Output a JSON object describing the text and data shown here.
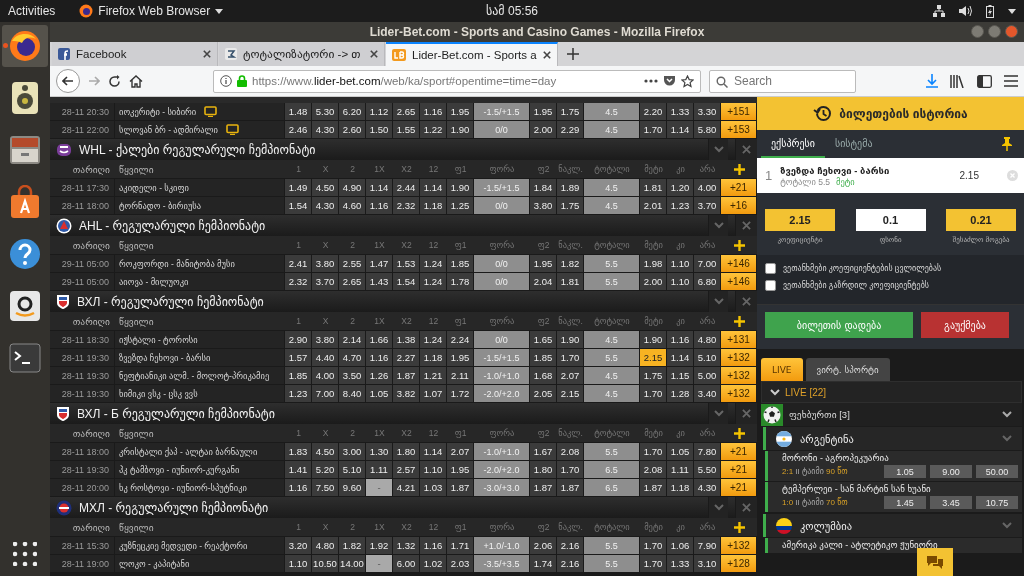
{
  "topbar": {
    "activities": "Activities",
    "app": "Firefox Web Browser",
    "clock": "სამ 05:56"
  },
  "dock": [
    {
      "kind": "firefox",
      "selected": true
    },
    {
      "kind": "music",
      "selected": false
    },
    {
      "kind": "files",
      "selected": false
    },
    {
      "kind": "software",
      "selected": false
    },
    {
      "kind": "help",
      "selected": false
    },
    {
      "kind": "amazon",
      "selected": false
    },
    {
      "kind": "terminal",
      "selected": false
    }
  ],
  "window": {
    "title": "Lider-Bet.com - Sports and Casino Games - Mozilla Firefox"
  },
  "tabs": [
    {
      "label": "Facebook",
      "kind": "facebook",
      "selected": false
    },
    {
      "label": "ტოტალიზატორი -> თ",
      "kind": "tote",
      "selected": false
    },
    {
      "label": "Lider-Bet.com - Sports a",
      "kind": "liderbet",
      "selected": true
    }
  ],
  "navbar": {
    "url": {
      "prefix": "https://www.",
      "domain": "lider-bet.com",
      "path": "/web/ka/sport#opentime=time=day"
    },
    "search": {
      "placeholder": "Search"
    }
  },
  "table": {
    "sections": [
      {
        "rows": [
          {
            "date": "28-11 20:30",
            "match": "იოკერიტი - სიბირი",
            "tv": true,
            "more": "+151",
            "odds": [
              {
                "value": "1.48",
                "selected": false,
                "disabled": false
              },
              {
                "value": "5.30",
                "selected": false,
                "disabled": false
              },
              {
                "value": "6.20",
                "selected": false,
                "disabled": false
              },
              {
                "value": "1.12",
                "selected": false,
                "disabled": false
              },
              {
                "value": "2.65",
                "selected": false,
                "disabled": false
              },
              {
                "value": "1.16",
                "selected": false,
                "disabled": false
              },
              {
                "value": "1.95",
                "selected": false,
                "disabled": false
              },
              {
                "value": "-1.5/+1.5",
                "selected": false,
                "disabled": false
              },
              {
                "value": "1.95",
                "selected": false,
                "disabled": false
              },
              {
                "value": "1.75",
                "selected": false,
                "disabled": false
              },
              {
                "value": "4.5",
                "selected": false,
                "disabled": false
              },
              {
                "value": "2.20",
                "selected": false,
                "disabled": false
              },
              {
                "value": "1.33",
                "selected": false,
                "disabled": false
              },
              {
                "value": "3.30",
                "selected": false,
                "disabled": false
              }
            ]
          },
          {
            "date": "28-11 22:00",
            "match": "სლოვან ბრ - ადმირალი",
            "tv": true,
            "more": "+153",
            "odds": [
              {
                "value": "2.46",
                "selected": false,
                "disabled": false
              },
              {
                "value": "4.30",
                "selected": false,
                "disabled": false
              },
              {
                "value": "2.60",
                "selected": false,
                "disabled": false
              },
              {
                "value": "1.50",
                "selected": false,
                "disabled": false
              },
              {
                "value": "1.55",
                "selected": false,
                "disabled": false
              },
              {
                "value": "1.22",
                "selected": false,
                "disabled": false
              },
              {
                "value": "1.90",
                "selected": false,
                "disabled": false
              },
              {
                "value": "0/0",
                "selected": false,
                "disabled": false
              },
              {
                "value": "2.00",
                "selected": false,
                "disabled": false
              },
              {
                "value": "2.29",
                "selected": false,
                "disabled": false
              },
              {
                "value": "4.5",
                "selected": false,
                "disabled": false
              },
              {
                "value": "1.70",
                "selected": false,
                "disabled": false
              },
              {
                "value": "1.14",
                "selected": false,
                "disabled": false
              },
              {
                "value": "5.80",
                "selected": false,
                "disabled": false
              }
            ]
          }
        ]
      },
      {
        "title": "WHL - ქალები რეგულარული ჩემპიონატი",
        "kind": "whl",
        "columns": [
          "თარიღი",
          "წყვილი",
          "1",
          "X",
          "2",
          "1X",
          "X2",
          "12",
          "ფ1",
          "ფორა",
          "ფ2",
          "ნაკლ.",
          "ტოტალი",
          "მეტი",
          "კი",
          "არა"
        ],
        "rows": [
          {
            "date": "28-11 17:30",
            "match": "აკიდელი - სკიფი",
            "tv": false,
            "more": "+21",
            "odds": [
              {
                "value": "1.49",
                "selected": false,
                "disabled": false
              },
              {
                "value": "4.50",
                "selected": false,
                "disabled": false
              },
              {
                "value": "4.90",
                "selected": false,
                "disabled": false
              },
              {
                "value": "1.14",
                "selected": false,
                "disabled": false
              },
              {
                "value": "2.44",
                "selected": false,
                "disabled": false
              },
              {
                "value": "1.14",
                "selected": false,
                "disabled": false
              },
              {
                "value": "1.90",
                "selected": false,
                "disabled": false
              },
              {
                "value": "-1.5/+1.5",
                "selected": false,
                "disabled": false
              },
              {
                "value": "1.84",
                "selected": false,
                "disabled": false
              },
              {
                "value": "1.89",
                "selected": false,
                "disabled": false
              },
              {
                "value": "4.5",
                "selected": false,
                "disabled": false
              },
              {
                "value": "1.81",
                "selected": false,
                "disabled": false
              },
              {
                "value": "1.20",
                "selected": false,
                "disabled": false
              },
              {
                "value": "4.00",
                "selected": false,
                "disabled": false
              }
            ]
          },
          {
            "date": "28-11 18:00",
            "match": "ტორნადო - ბირიუსა",
            "tv": false,
            "more": "+16",
            "odds": [
              {
                "value": "1.54",
                "selected": false,
                "disabled": false
              },
              {
                "value": "4.30",
                "selected": false,
                "disabled": false
              },
              {
                "value": "4.60",
                "selected": false,
                "disabled": false
              },
              {
                "value": "1.16",
                "selected": false,
                "disabled": false
              },
              {
                "value": "2.32",
                "selected": false,
                "disabled": false
              },
              {
                "value": "1.18",
                "selected": false,
                "disabled": false
              },
              {
                "value": "1.25",
                "selected": false,
                "disabled": false
              },
              {
                "value": "0/0",
                "selected": false,
                "disabled": false
              },
              {
                "value": "3.80",
                "selected": false,
                "disabled": false
              },
              {
                "value": "1.75",
                "selected": false,
                "disabled": false
              },
              {
                "value": "4.5",
                "selected": false,
                "disabled": false
              },
              {
                "value": "2.01",
                "selected": false,
                "disabled": false
              },
              {
                "value": "1.23",
                "selected": false,
                "disabled": false
              },
              {
                "value": "3.70",
                "selected": false,
                "disabled": false
              }
            ]
          }
        ]
      },
      {
        "title": "AHL - რეგულარული ჩემპიონატი",
        "kind": "ahl",
        "columns": [
          "თარიღი",
          "წყვილი",
          "1",
          "X",
          "2",
          "1X",
          "X2",
          "12",
          "ფ1",
          "ფორა",
          "ფ2",
          "ნაკლ.",
          "ტოტალი",
          "მეტი",
          "კი",
          "არა"
        ],
        "rows": [
          {
            "date": "29-11 05:00",
            "match": "როკფორდი - მანიტობა მუსი",
            "tv": false,
            "more": "+146",
            "odds": [
              {
                "value": "2.41",
                "selected": false,
                "disabled": false
              },
              {
                "value": "3.80",
                "selected": false,
                "disabled": false
              },
              {
                "value": "2.55",
                "selected": false,
                "disabled": false
              },
              {
                "value": "1.47",
                "selected": false,
                "disabled": false
              },
              {
                "value": "1.53",
                "selected": false,
                "disabled": false
              },
              {
                "value": "1.24",
                "selected": false,
                "disabled": false
              },
              {
                "value": "1.85",
                "selected": false,
                "disabled": false
              },
              {
                "value": "0/0",
                "selected": false,
                "disabled": false
              },
              {
                "value": "1.95",
                "selected": false,
                "disabled": false
              },
              {
                "value": "1.82",
                "selected": false,
                "disabled": false
              },
              {
                "value": "5.5",
                "selected": false,
                "disabled": false
              },
              {
                "value": "1.98",
                "selected": false,
                "disabled": false
              },
              {
                "value": "1.10",
                "selected": false,
                "disabled": false
              },
              {
                "value": "7.00",
                "selected": false,
                "disabled": false
              }
            ]
          },
          {
            "date": "29-11 05:00",
            "match": "აიოვა - მილუოკი",
            "tv": false,
            "more": "+146",
            "odds": [
              {
                "value": "2.32",
                "selected": false,
                "disabled": false
              },
              {
                "value": "3.70",
                "selected": false,
                "disabled": false
              },
              {
                "value": "2.65",
                "selected": false,
                "disabled": false
              },
              {
                "value": "1.43",
                "selected": false,
                "disabled": false
              },
              {
                "value": "1.54",
                "selected": false,
                "disabled": false
              },
              {
                "value": "1.24",
                "selected": false,
                "disabled": false
              },
              {
                "value": "1.78",
                "selected": false,
                "disabled": false
              },
              {
                "value": "0/0",
                "selected": false,
                "disabled": false
              },
              {
                "value": "2.04",
                "selected": false,
                "disabled": false
              },
              {
                "value": "1.81",
                "selected": false,
                "disabled": false
              },
              {
                "value": "5.5",
                "selected": false,
                "disabled": false
              },
              {
                "value": "2.00",
                "selected": false,
                "disabled": false
              },
              {
                "value": "1.10",
                "selected": false,
                "disabled": false
              },
              {
                "value": "6.80",
                "selected": false,
                "disabled": false
              }
            ]
          }
        ]
      },
      {
        "title": "ВХЛ - რეგულარული ჩემპიონატი",
        "kind": "vhl",
        "columns": [
          "თარიღი",
          "წყვილი",
          "1",
          "X",
          "2",
          "1X",
          "X2",
          "12",
          "ფ1",
          "ფორა",
          "ფ2",
          "ნაკლ.",
          "ტოტალი",
          "მეტი",
          "კი",
          "არა"
        ],
        "rows": [
          {
            "date": "28-11 18:30",
            "match": "იჟსტალი - ტოროსი",
            "tv": false,
            "more": "+131",
            "odds": [
              {
                "value": "2.90",
                "selected": false,
                "disabled": false
              },
              {
                "value": "3.80",
                "selected": false,
                "disabled": false
              },
              {
                "value": "2.14",
                "selected": false,
                "disabled": false
              },
              {
                "value": "1.66",
                "selected": false,
                "disabled": false
              },
              {
                "value": "1.38",
                "selected": false,
                "disabled": false
              },
              {
                "value": "1.24",
                "selected": false,
                "disabled": false
              },
              {
                "value": "2.24",
                "selected": false,
                "disabled": false
              },
              {
                "value": "0/0",
                "selected": false,
                "disabled": false
              },
              {
                "value": "1.65",
                "selected": false,
                "disabled": false
              },
              {
                "value": "1.90",
                "selected": false,
                "disabled": false
              },
              {
                "value": "4.5",
                "selected": false,
                "disabled": false
              },
              {
                "value": "1.90",
                "selected": false,
                "disabled": false
              },
              {
                "value": "1.16",
                "selected": false,
                "disabled": false
              },
              {
                "value": "4.80",
                "selected": false,
                "disabled": false
              }
            ]
          },
          {
            "date": "28-11 19:30",
            "match": "ზვეზდა ჩეხოვი - ბარსი",
            "tv": false,
            "more": "+132",
            "odds": [
              {
                "value": "1.57",
                "selected": false,
                "disabled": false
              },
              {
                "value": "4.40",
                "selected": false,
                "disabled": false
              },
              {
                "value": "4.70",
                "selected": false,
                "disabled": false
              },
              {
                "value": "1.16",
                "selected": false,
                "disabled": false
              },
              {
                "value": "2.27",
                "selected": false,
                "disabled": false
              },
              {
                "value": "1.18",
                "selected": false,
                "disabled": false
              },
              {
                "value": "1.95",
                "selected": false,
                "disabled": false
              },
              {
                "value": "-1.5/+1.5",
                "selected": false,
                "disabled": false
              },
              {
                "value": "1.85",
                "selected": false,
                "disabled": false
              },
              {
                "value": "1.70",
                "selected": false,
                "disabled": false
              },
              {
                "value": "5.5",
                "selected": false,
                "disabled": false
              },
              {
                "value": "2.15",
                "selected": true,
                "disabled": false
              },
              {
                "value": "1.14",
                "selected": false,
                "disabled": false
              },
              {
                "value": "5.10",
                "selected": false,
                "disabled": false
              }
            ]
          },
          {
            "date": "28-11 19:30",
            "match": "ნეფტიანიკი ალმ. - მოლოტ-პრიკამიე",
            "tv": false,
            "more": "+132",
            "odds": [
              {
                "value": "1.85",
                "selected": false,
                "disabled": false
              },
              {
                "value": "4.00",
                "selected": false,
                "disabled": false
              },
              {
                "value": "3.50",
                "selected": false,
                "disabled": false
              },
              {
                "value": "1.26",
                "selected": false,
                "disabled": false
              },
              {
                "value": "1.87",
                "selected": false,
                "disabled": false
              },
              {
                "value": "1.21",
                "selected": false,
                "disabled": false
              },
              {
                "value": "2.11",
                "selected": false,
                "disabled": false
              },
              {
                "value": "-1.0/+1.0",
                "selected": false,
                "disabled": false
              },
              {
                "value": "1.68",
                "selected": false,
                "disabled": false
              },
              {
                "value": "2.07",
                "selected": false,
                "disabled": false
              },
              {
                "value": "4.5",
                "selected": false,
                "disabled": false
              },
              {
                "value": "1.75",
                "selected": false,
                "disabled": false
              },
              {
                "value": "1.15",
                "selected": false,
                "disabled": false
              },
              {
                "value": "5.00",
                "selected": false,
                "disabled": false
              }
            ]
          },
          {
            "date": "28-11 19:30",
            "match": "ხიმიკი ვსკ - ცსკ ვვს",
            "tv": false,
            "more": "+132",
            "odds": [
              {
                "value": "1.23",
                "selected": false,
                "disabled": false
              },
              {
                "value": "7.00",
                "selected": false,
                "disabled": false
              },
              {
                "value": "8.40",
                "selected": false,
                "disabled": false
              },
              {
                "value": "1.05",
                "selected": false,
                "disabled": false
              },
              {
                "value": "3.82",
                "selected": false,
                "disabled": false
              },
              {
                "value": "1.07",
                "selected": false,
                "disabled": false
              },
              {
                "value": "1.72",
                "selected": false,
                "disabled": false
              },
              {
                "value": "-2.0/+2.0",
                "selected": false,
                "disabled": false
              },
              {
                "value": "2.05",
                "selected": false,
                "disabled": false
              },
              {
                "value": "2.15",
                "selected": false,
                "disabled": false
              },
              {
                "value": "4.5",
                "selected": false,
                "disabled": false
              },
              {
                "value": "1.70",
                "selected": false,
                "disabled": false
              },
              {
                "value": "1.28",
                "selected": false,
                "disabled": false
              },
              {
                "value": "3.40",
                "selected": false,
                "disabled": false
              }
            ]
          }
        ]
      },
      {
        "title": "ВХЛ - Б რეგულარული ჩემპიონატი",
        "kind": "vhl",
        "columns": [
          "თარიღი",
          "წყვილი",
          "1",
          "X",
          "2",
          "1X",
          "X2",
          "12",
          "ფ1",
          "ფორა",
          "ფ2",
          "ნაკლ.",
          "ტოტალი",
          "მეტი",
          "კი",
          "არა"
        ],
        "rows": [
          {
            "date": "28-11 18:00",
            "match": "კრისტალი ქაპ - ალტაი ბარნაული",
            "tv": false,
            "more": "+21",
            "odds": [
              {
                "value": "1.83",
                "selected": false,
                "disabled": false
              },
              {
                "value": "4.50",
                "selected": false,
                "disabled": false
              },
              {
                "value": "3.00",
                "selected": false,
                "disabled": false
              },
              {
                "value": "1.30",
                "selected": false,
                "disabled": false
              },
              {
                "value": "1.80",
                "selected": false,
                "disabled": false
              },
              {
                "value": "1.14",
                "selected": false,
                "disabled": false
              },
              {
                "value": "2.07",
                "selected": false,
                "disabled": false
              },
              {
                "value": "-1.0/+1.0",
                "selected": false,
                "disabled": false
              },
              {
                "value": "1.67",
                "selected": false,
                "disabled": false
              },
              {
                "value": "2.08",
                "selected": false,
                "disabled": false
              },
              {
                "value": "5.5",
                "selected": false,
                "disabled": false
              },
              {
                "value": "1.70",
                "selected": false,
                "disabled": false
              },
              {
                "value": "1.05",
                "selected": false,
                "disabled": false
              },
              {
                "value": "7.80",
                "selected": false,
                "disabled": false
              }
            ]
          },
          {
            "date": "28-11 19:30",
            "match": "ჰკ ტამბოვი - იუნიორ-კურგანი",
            "tv": false,
            "more": "+21",
            "odds": [
              {
                "value": "1.41",
                "selected": false,
                "disabled": false
              },
              {
                "value": "5.20",
                "selected": false,
                "disabled": false
              },
              {
                "value": "5.10",
                "selected": false,
                "disabled": false
              },
              {
                "value": "1.11",
                "selected": false,
                "disabled": false
              },
              {
                "value": "2.57",
                "selected": false,
                "disabled": false
              },
              {
                "value": "1.10",
                "selected": false,
                "disabled": false
              },
              {
                "value": "1.95",
                "selected": false,
                "disabled": false
              },
              {
                "value": "-2.0/+2.0",
                "selected": false,
                "disabled": false
              },
              {
                "value": "1.80",
                "selected": false,
                "disabled": false
              },
              {
                "value": "1.70",
                "selected": false,
                "disabled": false
              },
              {
                "value": "6.5",
                "selected": false,
                "disabled": false
              },
              {
                "value": "2.08",
                "selected": false,
                "disabled": false
              },
              {
                "value": "1.11",
                "selected": false,
                "disabled": false
              },
              {
                "value": "5.50",
                "selected": false,
                "disabled": false
              }
            ]
          },
          {
            "date": "28-11 20:00",
            "match": "ხკ როსტოვი - იუნიორ-სპუტნიკი",
            "tv": false,
            "more": "+21",
            "odds": [
              {
                "value": "1.16",
                "selected": false,
                "disabled": false
              },
              {
                "value": "7.50",
                "selected": false,
                "disabled": false
              },
              {
                "value": "9.60",
                "selected": false,
                "disabled": false
              },
              {
                "value": "-",
                "selected": false,
                "disabled": true
              },
              {
                "value": "4.21",
                "selected": false,
                "disabled": false
              },
              {
                "value": "1.03",
                "selected": false,
                "disabled": false
              },
              {
                "value": "1.87",
                "selected": false,
                "disabled": false
              },
              {
                "value": "-3.0/+3.0",
                "selected": false,
                "disabled": false
              },
              {
                "value": "1.87",
                "selected": false,
                "disabled": false
              },
              {
                "value": "1.87",
                "selected": false,
                "disabled": false
              },
              {
                "value": "6.5",
                "selected": false,
                "disabled": false
              },
              {
                "value": "1.87",
                "selected": false,
                "disabled": false
              },
              {
                "value": "1.18",
                "selected": false,
                "disabled": false
              },
              {
                "value": "4.30",
                "selected": false,
                "disabled": false
              }
            ]
          }
        ]
      },
      {
        "title": "МХЛ - რეგულარული ჩემპიონატი",
        "kind": "mhl",
        "columns": [
          "თარიღი",
          "წყვილი",
          "1",
          "X",
          "2",
          "1X",
          "X2",
          "12",
          "ფ1",
          "ფორა",
          "ფ2",
          "ნაკლ.",
          "ტოტალი",
          "მეტი",
          "კი",
          "არა"
        ],
        "rows": [
          {
            "date": "28-11 15:30",
            "match": "კუზნეცკიე მედვედი - რეაქტორი",
            "tv": false,
            "more": "+132",
            "odds": [
              {
                "value": "3.20",
                "selected": false,
                "disabled": false
              },
              {
                "value": "4.80",
                "selected": false,
                "disabled": false
              },
              {
                "value": "1.82",
                "selected": false,
                "disabled": false
              },
              {
                "value": "1.92",
                "selected": false,
                "disabled": false
              },
              {
                "value": "1.32",
                "selected": false,
                "disabled": false
              },
              {
                "value": "1.16",
                "selected": false,
                "disabled": false
              },
              {
                "value": "1.71",
                "selected": false,
                "disabled": false
              },
              {
                "value": "+1.0/-1.0",
                "selected": false,
                "disabled": false
              },
              {
                "value": "2.06",
                "selected": false,
                "disabled": false
              },
              {
                "value": "2.16",
                "selected": false,
                "disabled": false
              },
              {
                "value": "5.5",
                "selected": false,
                "disabled": false
              },
              {
                "value": "1.70",
                "selected": false,
                "disabled": false
              },
              {
                "value": "1.06",
                "selected": false,
                "disabled": false
              },
              {
                "value": "7.90",
                "selected": false,
                "disabled": false
              }
            ]
          },
          {
            "date": "28-11 19:00",
            "match": "ლოკო - კაპიტანი",
            "tv": false,
            "more": "+128",
            "odds": [
              {
                "value": "1.10",
                "selected": false,
                "disabled": false
              },
              {
                "value": "10.50",
                "selected": false,
                "disabled": false
              },
              {
                "value": "14.00",
                "selected": false,
                "disabled": false
              },
              {
                "value": "-",
                "selected": false,
                "disabled": true
              },
              {
                "value": "6.00",
                "selected": false,
                "disabled": false
              },
              {
                "value": "1.02",
                "selected": false,
                "disabled": false
              },
              {
                "value": "2.03",
                "selected": false,
                "disabled": false
              },
              {
                "value": "-3.5/+3.5",
                "selected": false,
                "disabled": false
              },
              {
                "value": "1.74",
                "selected": false,
                "disabled": false
              },
              {
                "value": "2.16",
                "selected": false,
                "disabled": false
              },
              {
                "value": "5.5",
                "selected": false,
                "disabled": false
              },
              {
                "value": "1.70",
                "selected": false,
                "disabled": false
              },
              {
                "value": "1.33",
                "selected": false,
                "disabled": false
              },
              {
                "value": "3.10",
                "selected": false,
                "disabled": false
              }
            ]
          }
        ]
      }
    ]
  },
  "betslip": {
    "header": "ბილეთების ისტორია",
    "tabs": [
      {
        "label": "ექსპრესი",
        "selected": true
      },
      {
        "label": "სისტემა",
        "selected": false
      }
    ],
    "bets": [
      {
        "number": "1",
        "match": "ზვეზდა ჩეხოვი - ბარსი",
        "market": "ტოტალი 5.5",
        "pick": "მეტი",
        "odd": "2.15"
      }
    ],
    "summary": [
      {
        "kind": "display",
        "value": "2.15",
        "label": "კოეფიციენტი"
      },
      {
        "kind": "input",
        "value": "0.1",
        "label": "ფსონი"
      },
      {
        "kind": "display",
        "value": "0.21",
        "label": "შესაძლო მოგება"
      }
    ],
    "options": [
      {
        "label": "ვეთანხმები კოეფიციენტების ცვლილებას",
        "checked": false
      },
      {
        "label": "ვეთანხმები გაზრდილ კოეფიციენტებს",
        "checked": false
      }
    ],
    "buttons": [
      {
        "label": "ბილეთის დადება",
        "kind": "primary"
      },
      {
        "label": "გაუქმება",
        "kind": "danger"
      }
    ]
  },
  "live": {
    "tabs": [
      {
        "label": "LIVE",
        "selected": true
      },
      {
        "label": "ვირტ. სპორტი",
        "selected": false
      }
    ],
    "title": "LIVE [22]",
    "sports": [
      {
        "name": "ფეხბურთი [3]",
        "countries": [
          {
            "name": "არგენტინა",
            "kind": "argentina",
            "matches": [
              {
                "teams": "მორონი - აგროპეკუარია",
                "score": "2:1",
                "period": "II ტაიმი",
                "minute": "90 წთ",
                "odds": [
                  "1.05",
                  "9.00",
                  "50.00"
                ]
              },
              {
                "teams": "ტემპერლეი - სან მარტინ სან ხუანი",
                "score": "1:0",
                "period": "II ტაიმი",
                "minute": "70 წთ",
                "odds": [
                  "1.45",
                  "3.45",
                  "10.75"
                ]
              }
            ]
          },
          {
            "name": "კოლუმბია",
            "kind": "colombia",
            "matches": [
              {
                "teams": "ამერიკა კალი - ატლეტიკო ჟუნიორი"
              }
            ]
          }
        ]
      }
    ]
  }
}
